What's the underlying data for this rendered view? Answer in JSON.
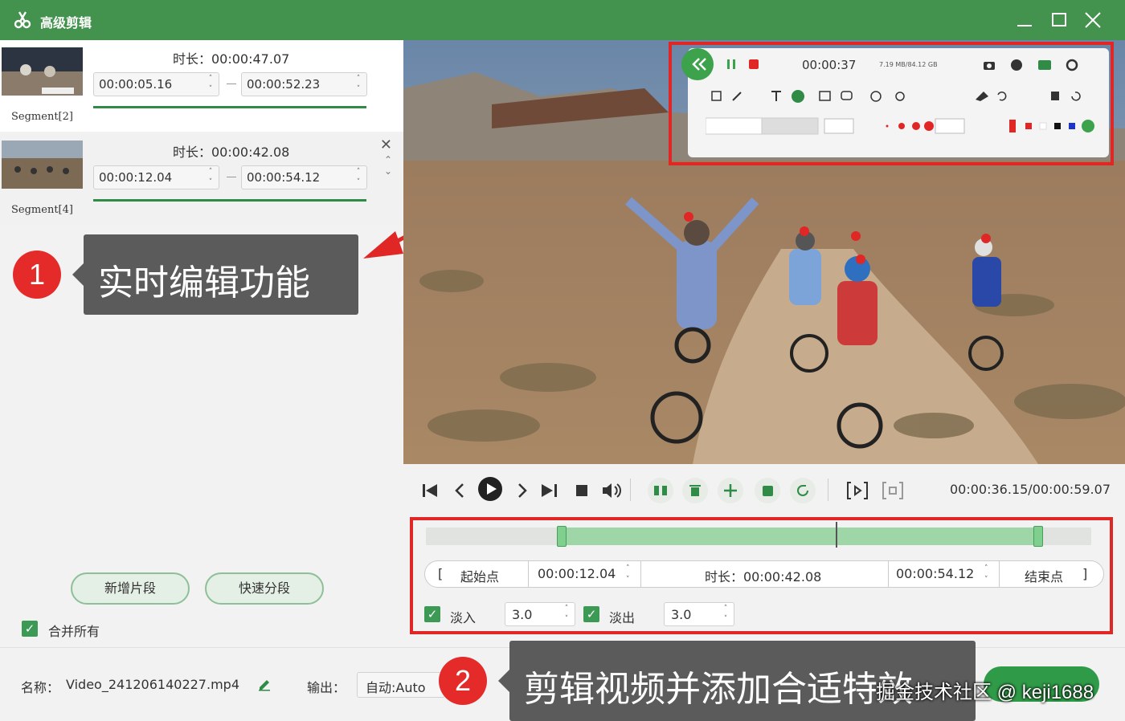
{
  "titlebar": {
    "title": "高级剪辑"
  },
  "segments": [
    {
      "label": "Segment[2]",
      "duration": "时长：00:00:47.07",
      "start": "00:00:05.16",
      "end": "00:00:52.23"
    },
    {
      "label": "Segment[4]",
      "duration": "时长：00:00:42.08",
      "start": "00:00:12.04",
      "end": "00:00:54.12"
    }
  ],
  "left_buttons": {
    "add_segment": "新增片段",
    "quick_split": "快速分段"
  },
  "merge_all": {
    "label": "合并所有",
    "checked": true
  },
  "callouts": {
    "first": {
      "number": "1",
      "text": "实时编辑功能"
    },
    "second": {
      "number": "2",
      "text": "剪辑视频并添加合适特效"
    }
  },
  "recorder_panel": {
    "time": "00:00:37",
    "size": "7.19 MB/84.12 GB"
  },
  "player": {
    "timecode": "00:00:36.15/00:00:59.07"
  },
  "range": {
    "start_label": "起始点",
    "start_value": "00:00:12.04",
    "duration": "时长：00:00:42.08",
    "end_value": "00:00:54.12",
    "end_label": "结束点"
  },
  "fade": {
    "in_label": "淡入",
    "in_value": "3.0",
    "out_label": "淡出",
    "out_value": "3.0"
  },
  "bottom": {
    "name_label": "名称：",
    "filename": "Video_241206140227.mp4",
    "output_label": "输出：",
    "output_value": "自动:Auto"
  },
  "watermark": "掘金技术社区 @ keji1688",
  "icons": [
    "scissors-logo-icon",
    "minimize-icon",
    "maximize-icon",
    "close-icon",
    "play-icon",
    "pause-icon",
    "stop-icon",
    "volume-icon",
    "delete-icon",
    "add-icon",
    "refresh-icon",
    "edit-icon"
  ],
  "colors": {
    "brand": "#43924d",
    "accent": "#2f8b46",
    "highlight": "#e12626"
  }
}
